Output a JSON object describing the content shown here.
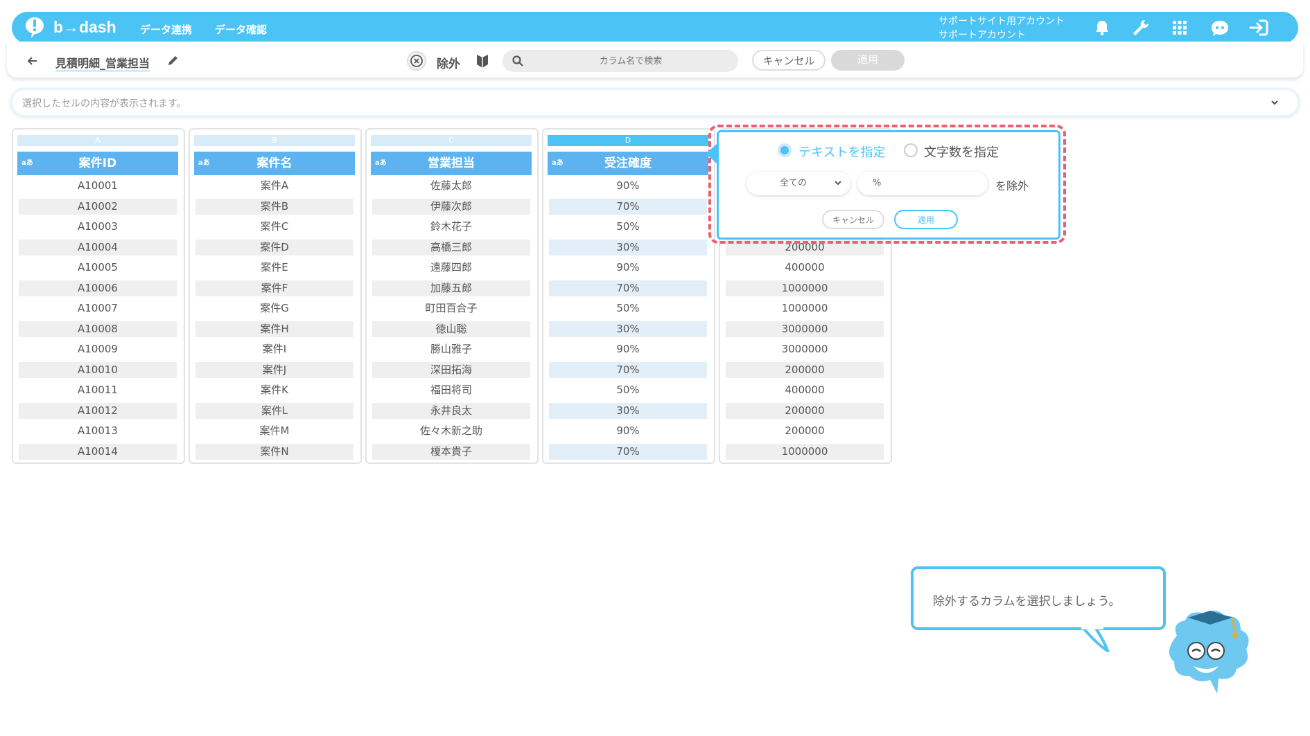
{
  "header": {
    "brand": "b→dash",
    "nav": [
      "データ連携",
      "データ確認"
    ],
    "account_line1": "サポートサイト用アカウント",
    "account_line2": "サポートアカウント",
    "icons": [
      "bell-icon",
      "wrench-icon",
      "grid-icon",
      "assistant-icon",
      "logout-icon"
    ]
  },
  "toolbar": {
    "title": "見積明細_営業担当",
    "exclude_label": "除外",
    "search_placeholder": "カラム名で検索",
    "cancel_label": "キャンセル",
    "apply_label": "適用"
  },
  "cell_bar": {
    "placeholder": "選択したセルの内容が表示されます。"
  },
  "columns": [
    {
      "letter": "A",
      "type": "aあ",
      "name": "案件ID",
      "cells": [
        "A10001",
        "A10002",
        "A10003",
        "A10004",
        "A10005",
        "A10006",
        "A10007",
        "A10008",
        "A10009",
        "A10010",
        "A10011",
        "A10012",
        "A10013",
        "A10014"
      ]
    },
    {
      "letter": "B",
      "type": "aあ",
      "name": "案件名",
      "cells": [
        "案件A",
        "案件B",
        "案件C",
        "案件D",
        "案件E",
        "案件F",
        "案件G",
        "案件H",
        "案件I",
        "案件J",
        "案件K",
        "案件L",
        "案件M",
        "案件N"
      ]
    },
    {
      "letter": "C",
      "type": "aあ",
      "name": "営業担当",
      "cells": [
        "佐藤太郎",
        "伊藤次郎",
        "鈴木花子",
        "高橋三郎",
        "遠藤四郎",
        "加藤五郎",
        "町田百合子",
        "徳山聡",
        "勝山雅子",
        "深田拓海",
        "福田将司",
        "永井良太",
        "佐々木新之助",
        "榎本貴子"
      ]
    },
    {
      "letter": "D",
      "type": "aあ",
      "name": "受注確度",
      "cells": [
        "90%",
        "70%",
        "50%",
        "30%",
        "90%",
        "70%",
        "50%",
        "30%",
        "90%",
        "70%",
        "50%",
        "30%",
        "90%",
        "70%"
      ]
    },
    {
      "letter": "",
      "type": "",
      "name": "",
      "cells": [
        "",
        "",
        "",
        "200000",
        "400000",
        "1000000",
        "1000000",
        "3000000",
        "3000000",
        "200000",
        "400000",
        "200000",
        "200000",
        "1000000"
      ]
    }
  ],
  "popup": {
    "radio_text": "テキストを指定",
    "radio_length": "文字数を指定",
    "select_value": "全ての",
    "input_value": "%",
    "suffix": "を除外",
    "cancel_label": "キャンセル",
    "apply_label": "適用"
  },
  "bubble": {
    "text": "除外するカラムを選択しましょう。"
  },
  "colors": {
    "primary": "#4cc3f5",
    "header_blue": "#5cb3f0",
    "highlight_red": "#ee5e73"
  }
}
